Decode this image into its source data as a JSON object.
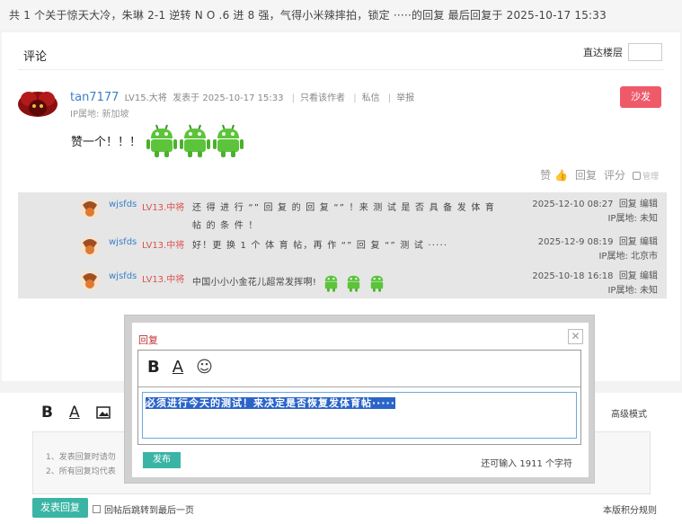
{
  "header": {
    "summary": "共 1 个关于惊天大冷，朱琳 2-1 逆转 N O .6 进 8 强，气得小米辣摔拍，锁定 ·····的回复 最后回复于 2025-10-17 15:33"
  },
  "comments": {
    "title": "评论",
    "jump_label": "直达楼层"
  },
  "post": {
    "author": "tan7177",
    "level": "LV15.大将",
    "posted": "发表于 2025-10-17 15:33",
    "only_author": "只看该作者",
    "private_msg": "私信",
    "report": "举报",
    "ip": "IP属地: 新加坡",
    "floor_badge": "沙发",
    "body": "赞一个！！！",
    "emoji_count": 3,
    "actions": {
      "like": "赞",
      "reply": "回复",
      "rate": "评分",
      "manage": "管理"
    }
  },
  "replies": [
    {
      "user": "wjsfds",
      "level": "LV13.中将",
      "text": "还 得 进 行 “” 回 复 的 回 复 “” ！来 测 试 是 否 具 备 发 体 育 帖 的 条 件 ！",
      "time": "2025-12-10 08:27",
      "reply": "回复",
      "edit": "编辑",
      "ip": "IP属地: 未知"
    },
    {
      "user": "wjsfds",
      "level": "LV13.中将",
      "text": "好！更 换 1 个 体 育 帖，再 作 “” 回 复 “” 测 试 ·····",
      "time": "2025-12-9 08:19",
      "reply": "回复",
      "edit": "编辑",
      "ip": "IP属地: 北京市"
    },
    {
      "user": "wjsfds",
      "level": "LV13.中将",
      "text": "中国小小小金花儿超常发挥啊!",
      "time": "2025-10-18 16:18",
      "reply": "回复",
      "edit": "编辑",
      "ip": "IP属地: 未知",
      "emoji_count": 3
    }
  ],
  "editor": {
    "advanced": "高级模式",
    "tip1": "1、发表回复时请勿",
    "tip2": "2、所有回复均代表",
    "submit": "发表回复",
    "jump_last": "回帖后跳转到最后一页",
    "rules": "本版积分规则"
  },
  "dialog": {
    "title": "回复",
    "text": "必须进行今天的测试！来决定是否恢复发体育帖·····",
    "submit": "发布",
    "remaining": "还可输入 1911 个字符"
  },
  "colors": {
    "accent_teal": "#3ab5a5",
    "badge_red": "#ee5a6a",
    "link_blue": "#3a7fc9",
    "level_red": "#d9534f",
    "selection_blue": "#2b64c9"
  }
}
